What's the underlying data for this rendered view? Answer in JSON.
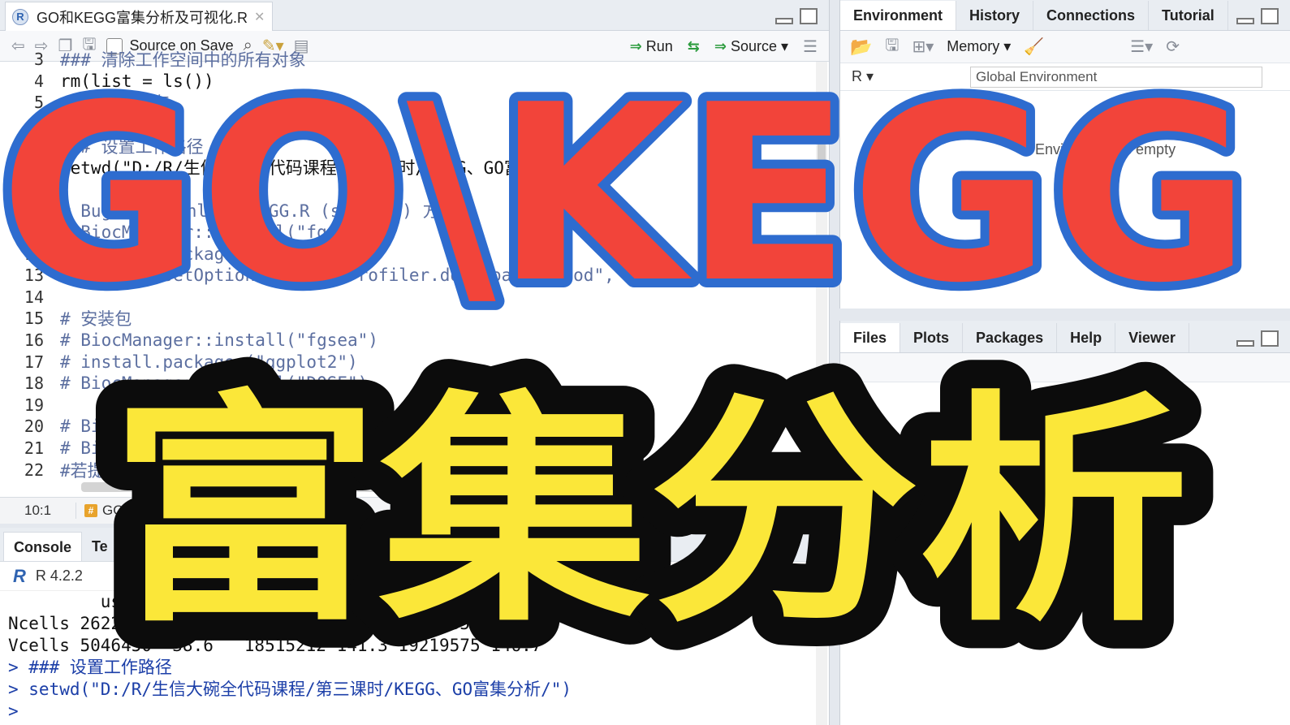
{
  "editor": {
    "file_tab": "GO和KEGG富集分析及可视化.R",
    "toolbar": {
      "source_on_save": "Source on Save",
      "run": "Run",
      "source": "Source"
    },
    "lines": [
      {
        "n": "3",
        "text": "### 清除工作空间中的所有对象",
        "type": "comment"
      },
      {
        "n": "4",
        "text": "rm(list = ls())",
        "type": "code"
      },
      {
        "n": "5",
        "text": "### 清理内存",
        "type": "comment"
      },
      {
        "n": "6",
        "text": "gc()",
        "type": "code"
      },
      {
        "n": "7",
        "text": "### 设置工作路径",
        "type": "comment"
      },
      {
        "n": "8",
        "text": "setwd(\"D:/R/生信大碗全代码课程/第三课时/KEGG、GO富集分析/\")",
        "type": "code"
      },
      {
        "n": "9",
        "text": "",
        "type": "code"
      },
      {
        "n": "10",
        "text": "# Bug修复 download_KEGG.R (species) 方法",
        "type": "comment"
      },
      {
        "n": "11",
        "text": "# BiocManager::install(\"fgsea\")",
        "type": "comment"
      },
      {
        "n": "12",
        "text": "# install.packages(\"R.utils\")",
        "type": "comment"
      },
      {
        "n": "13",
        "text": "#R.utils::setOption(\"clusterProfiler.download.method\",'auto' )",
        "type": "comment"
      },
      {
        "n": "14",
        "text": "",
        "type": "code"
      },
      {
        "n": "15",
        "text": "# 安装包",
        "type": "comment"
      },
      {
        "n": "16",
        "text": "# BiocManager::install(\"fgsea\")",
        "type": "comment"
      },
      {
        "n": "17",
        "text": "# install.packages(\"ggplot2\")",
        "type": "comment"
      },
      {
        "n": "18",
        "text": "# BiocManager::install(\"DOSE\")",
        "type": "comment"
      },
      {
        "n": "19",
        "text": "",
        "type": "code"
      },
      {
        "n": "20",
        "text": "# BiocManager::install(\"clusterProfiler\")",
        "type": "comment"
      },
      {
        "n": "21",
        "text": "# BiocManager::install(\"org.Hs.eg.db\")",
        "type": "comment"
      },
      {
        "n": "22",
        "text": "#若提示没有某个包则安装",
        "type": "comment"
      },
      {
        "n": "23",
        "text": "",
        "type": "code"
      }
    ],
    "status": {
      "position": "10:1",
      "section": "GO"
    }
  },
  "console": {
    "tab_console": "Console",
    "tab_terminal": "Te",
    "version": "R 4.2.2",
    "lines": [
      {
        "text": "         used  (Mb) gc trigger  (Mb) max used  (Mb)",
        "type": "out"
      },
      {
        "text": "Ncells 2622089 140.1    4649850 248.4  4649850 248.4",
        "type": "out"
      },
      {
        "text": "Vcells 5046450  38.6   18515212 141.3 19219575 146.7",
        "type": "out"
      },
      {
        "text": "> ### 设置工作路径",
        "type": "cmd"
      },
      {
        "text": "> setwd(\"D:/R/生信大碗全代码课程/第三课时/KEGG、GO富集分析/\")",
        "type": "cmd"
      },
      {
        "text": "> ",
        "type": "cmd"
      }
    ]
  },
  "env_pane": {
    "tabs": [
      "Environment",
      "History",
      "Connections",
      "Tutorial"
    ],
    "memory": "Memory",
    "r_selector": "R",
    "env_label": "Global Environment",
    "empty_text": "Environment is empty"
  },
  "files_pane": {
    "tabs": [
      "Files",
      "Plots",
      "Packages",
      "Help",
      "Viewer"
    ]
  },
  "overlay": {
    "line1": "GO\\KEGG",
    "line2": "富集分析",
    "colors": {
      "red": "#f2443a",
      "blue": "#2e6ccf",
      "yellow": "#fbe739",
      "black": "#0c0c0c"
    }
  }
}
